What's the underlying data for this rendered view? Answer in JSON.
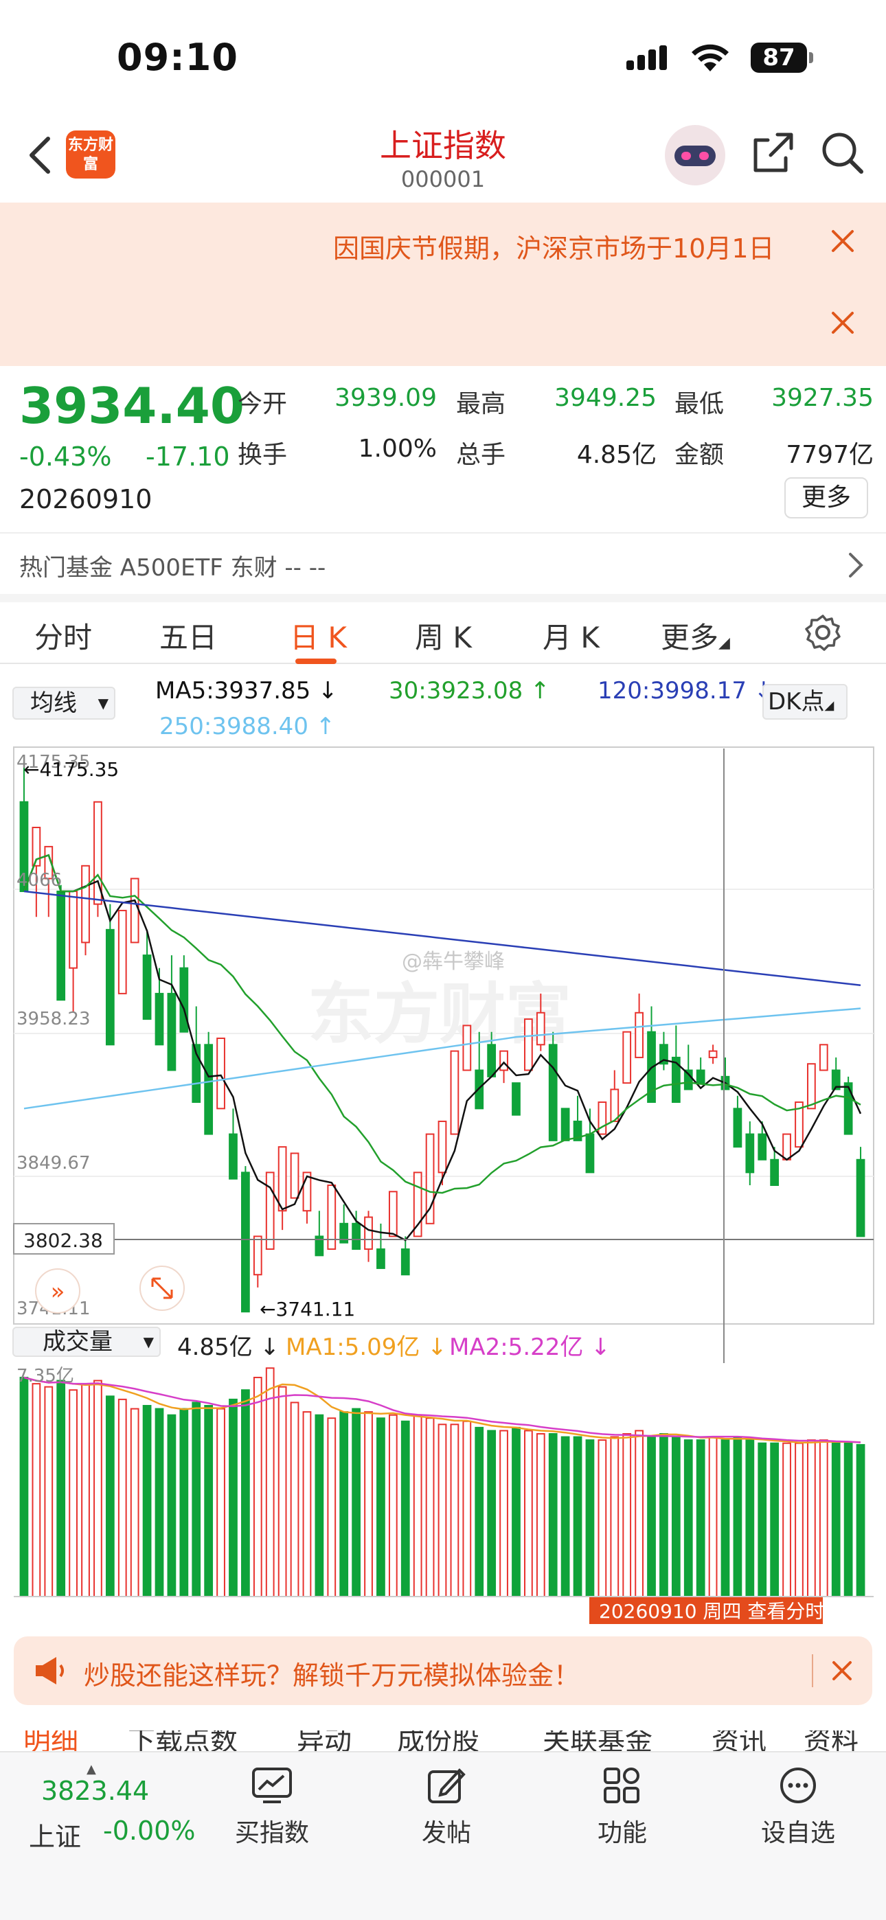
{
  "status": {
    "time": "09:10",
    "battery": "87"
  },
  "nav": {
    "logo": "东方财富",
    "title": "上证指数",
    "code": "000001"
  },
  "notice": {
    "text": "因国庆节假期，沪深京市场于10月1日"
  },
  "quote": {
    "price": "3934.40",
    "change_pct": "-0.43%",
    "change_val": "-17.10",
    "date": "20260910",
    "stats": [
      {
        "label": "今开",
        "value": "3939.09",
        "color": "#1a9f3a"
      },
      {
        "label": "最高",
        "value": "3949.25",
        "color": "#1a9f3a"
      },
      {
        "label": "最低",
        "value": "3927.35",
        "color": "#1a9f3a"
      },
      {
        "label": "换手",
        "value": "1.00%",
        "color": "#222222"
      },
      {
        "label": "总手",
        "value": "4.85亿",
        "color": "#222222"
      },
      {
        "label": "金额",
        "value": "7797亿",
        "color": "#222222"
      }
    ],
    "more": "更多"
  },
  "hot": {
    "text": "热门基金  A500ETF 东财 -- --"
  },
  "tabs": [
    "分时",
    "五日",
    "日 K",
    "周 K",
    "月 K",
    "更多"
  ],
  "ma_bar": {
    "dropdown": "均线",
    "ma5": "MA5:3937.85 ↓",
    "ma30": "30:3923.08 ↑",
    "ma120": "120:3998.17 ↓",
    "ma250": "250:3988.40 ↑",
    "dk": "DK点"
  },
  "price_axis": {
    "top": "4175.35",
    "l2": "4066",
    "l3": "3958.23",
    "l4": "3849.67",
    "current": "3802.38",
    "bottom": "3741.11",
    "max_marker": "←4175.35",
    "min_marker": "←3741.11"
  },
  "vol_bar": {
    "dropdown": "成交量",
    "vol": "4.85亿 ↓",
    "ma1": "MA1:5.09亿 ↓",
    "ma2": "MA2:5.22亿 ↓",
    "axis_top": "7.35亿"
  },
  "date_tag": "20260910 周四  查看分时",
  "watermark": "@犇牛攀峰",
  "bg_watermark": "东方财富",
  "promo": {
    "text": "炒股还能这样玩？解锁千万元模拟体验金！"
  },
  "under_tabs": [
    "明细",
    "下载点数",
    "异动",
    "成份股",
    "关联基金",
    "资讯",
    "资料"
  ],
  "bottom": {
    "index_value": "3823.44",
    "index_name": "上证",
    "index_change": "-0.00%",
    "items": [
      {
        "icon": "trend-chart-icon",
        "label": "买指数"
      },
      {
        "icon": "edit-post-icon",
        "label": "发帖"
      },
      {
        "icon": "grid-function-icon",
        "label": "功能"
      },
      {
        "icon": "more-dots-icon",
        "label": "设自选"
      }
    ]
  },
  "colors": {
    "up": "#e8322e",
    "down": "#0fa33a",
    "accent": "#f0551e",
    "ma5": "#111111",
    "ma30": "#22a02c",
    "ma120": "#2a3fb5",
    "ma250": "#6ec3ef",
    "vol_ma1": "#f0a020",
    "vol_ma2": "#d63ec8"
  },
  "chart_data": {
    "type": "candlestick",
    "y_range": [
      3741.11,
      4175.35
    ],
    "candles": [
      [
        4140,
        4175,
        4090,
        4070
      ],
      [
        4090,
        4110,
        4050,
        4120
      ],
      [
        4080,
        4095,
        4050,
        4105
      ],
      [
        4070,
        4075,
        4000,
        3985
      ],
      [
        4010,
        4060,
        3975,
        4070
      ],
      [
        4030,
        4080,
        4020,
        4090
      ],
      [
        4060,
        4110,
        4050,
        4140
      ],
      [
        4040,
        4060,
        3960,
        3950
      ],
      [
        3990,
        4040,
        3995,
        4055
      ],
      [
        4030,
        4060,
        4030,
        4080
      ],
      [
        4020,
        4040,
        3980,
        3970
      ],
      [
        3990,
        4010,
        3960,
        3950
      ],
      [
        3990,
        4020,
        3940,
        3930
      ],
      [
        4010,
        4020,
        3965,
        3960
      ],
      [
        3950,
        3980,
        3930,
        3905
      ],
      [
        3950,
        3960,
        3890,
        3880
      ],
      [
        3900,
        3940,
        3900,
        3955
      ],
      [
        3880,
        3900,
        3850,
        3845
      ],
      [
        3850,
        3855,
        3760,
        3741
      ],
      [
        3770,
        3800,
        3760,
        3800
      ],
      [
        3790,
        3840,
        3790,
        3850
      ],
      [
        3820,
        3860,
        3805,
        3870
      ],
      [
        3830,
        3850,
        3830,
        3865
      ],
      [
        3820,
        3845,
        3810,
        3850
      ],
      [
        3800,
        3820,
        3790,
        3785
      ],
      [
        3790,
        3830,
        3790,
        3840
      ],
      [
        3810,
        3825,
        3795,
        3795
      ],
      [
        3810,
        3820,
        3790,
        3790
      ],
      [
        3790,
        3820,
        3780,
        3815
      ],
      [
        3790,
        3810,
        3790,
        3775
      ],
      [
        3800,
        3810,
        3800,
        3835
      ],
      [
        3790,
        3800,
        3780,
        3770
      ],
      [
        3800,
        3820,
        3800,
        3850
      ],
      [
        3810,
        3880,
        3810,
        3880
      ],
      [
        3850,
        3880,
        3840,
        3890
      ],
      [
        3880,
        3940,
        3890,
        3945
      ],
      [
        3930,
        3950,
        3935,
        3965
      ],
      [
        3930,
        3960,
        3910,
        3900
      ],
      [
        3950,
        3960,
        3940,
        3925
      ],
      [
        3930,
        3945,
        3920,
        3945
      ],
      [
        3920,
        3920,
        3910,
        3895
      ],
      [
        3930,
        3950,
        3930,
        3970
      ],
      [
        3950,
        3990,
        3945,
        3975
      ],
      [
        3950,
        3960,
        3890,
        3875
      ],
      [
        3900,
        3900,
        3880,
        3875
      ],
      [
        3890,
        3910,
        3880,
        3875
      ],
      [
        3880,
        3900,
        3855,
        3850
      ],
      [
        3880,
        3900,
        3880,
        3905
      ],
      [
        3890,
        3930,
        3890,
        3915
      ],
      [
        3920,
        3950,
        3920,
        3960
      ],
      [
        3940,
        3990,
        3940,
        3975
      ],
      [
        3960,
        3980,
        3920,
        3905
      ],
      [
        3950,
        3960,
        3930,
        3935
      ],
      [
        3940,
        3965,
        3920,
        3905
      ],
      [
        3930,
        3950,
        3920,
        3915
      ],
      [
        3930,
        3940,
        3925,
        3920
      ],
      [
        3940,
        3950,
        3935,
        3945
      ],
      [
        3925,
        3940,
        3915,
        3915
      ],
      [
        3900,
        3910,
        3880,
        3870
      ],
      [
        3880,
        3890,
        3840,
        3850
      ],
      [
        3880,
        3890,
        3860,
        3860
      ],
      [
        3860,
        3870,
        3840,
        3840
      ],
      [
        3860,
        3880,
        3860,
        3880
      ],
      [
        3870,
        3900,
        3870,
        3905
      ],
      [
        3900,
        3930,
        3900,
        3935
      ],
      [
        3930,
        3950,
        3935,
        3950
      ],
      [
        3930,
        3940,
        3915,
        3915
      ],
      [
        3920,
        3925,
        3880,
        3880
      ],
      [
        3860,
        3870,
        3805,
        3800
      ]
    ],
    "volume_max": 7.35,
    "volumes": [
      7.0,
      6.8,
      6.7,
      6.9,
      6.6,
      6.8,
      6.9,
      6.4,
      6.3,
      6.0,
      6.1,
      6.0,
      5.8,
      6.0,
      6.2,
      6.1,
      6.0,
      6.3,
      6.6,
      7.0,
      7.3,
      6.7,
      6.2,
      5.9,
      5.8,
      5.7,
      5.9,
      6.0,
      5.9,
      5.7,
      5.8,
      5.6,
      5.8,
      5.7,
      5.5,
      5.5,
      5.6,
      5.4,
      5.3,
      5.3,
      5.4,
      5.3,
      5.2,
      5.2,
      5.1,
      5.1,
      5.0,
      5.0,
      5.1,
      5.2,
      5.3,
      5.1,
      5.2,
      5.1,
      5.0,
      5.0,
      5.1,
      5.0,
      5.1,
      5.0,
      4.9,
      4.9,
      4.9,
      4.9,
      5.0,
      5.0,
      4.9,
      4.9,
      4.85
    ]
  }
}
